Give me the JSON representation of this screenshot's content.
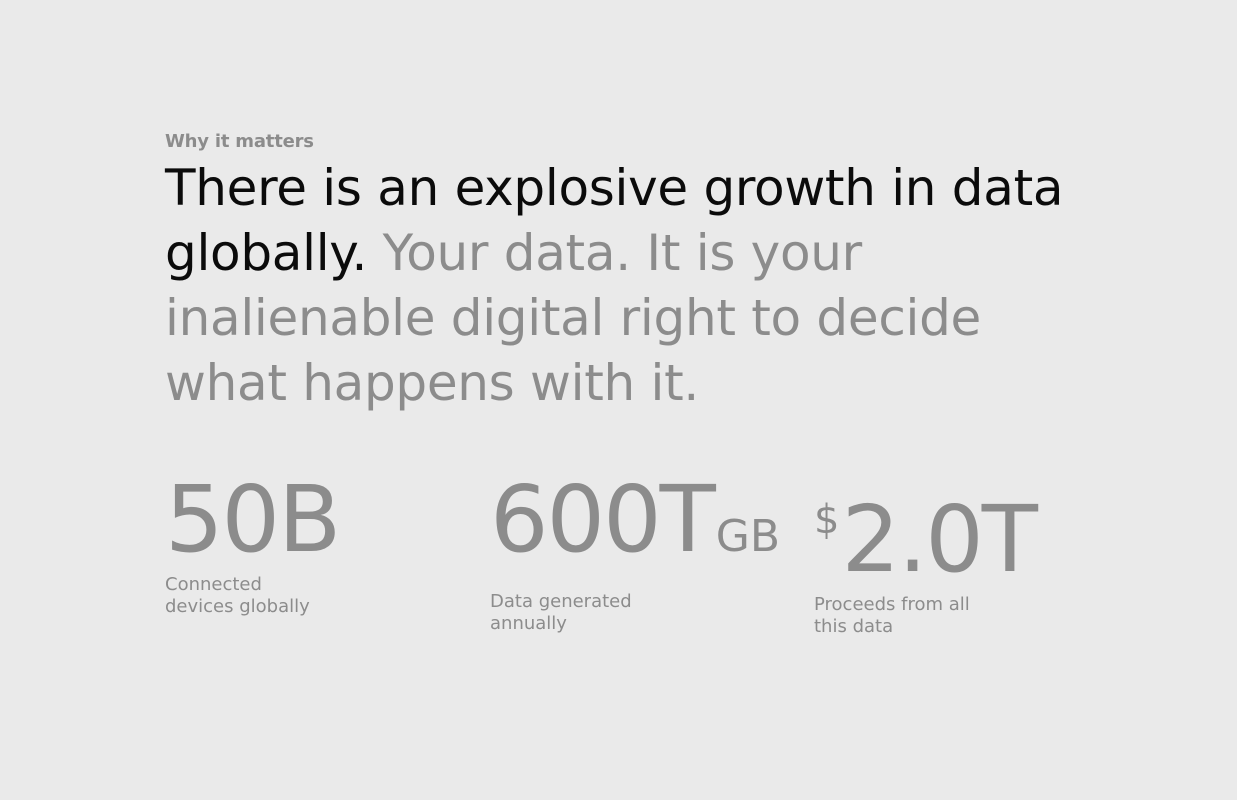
{
  "section": {
    "eyebrow": "Why it matters",
    "headline_dark": "There is an explosive growth in data globally.",
    "headline_muted": " Your data. It is your inalienable digital right to decide what happens with it."
  },
  "stats": [
    {
      "prefix": "",
      "value": "50B",
      "unit": "",
      "label": "Connected devices globally"
    },
    {
      "prefix": "",
      "value": "600T",
      "unit": "GB",
      "label": "Data generated annually"
    },
    {
      "prefix": "$",
      "value": "2.0T",
      "unit": "",
      "label": "Proceeds from all this data"
    }
  ],
  "colors": {
    "background": "#eaeaea",
    "text_dark": "#0b0b0b",
    "text_muted": "#8c8c8c"
  }
}
